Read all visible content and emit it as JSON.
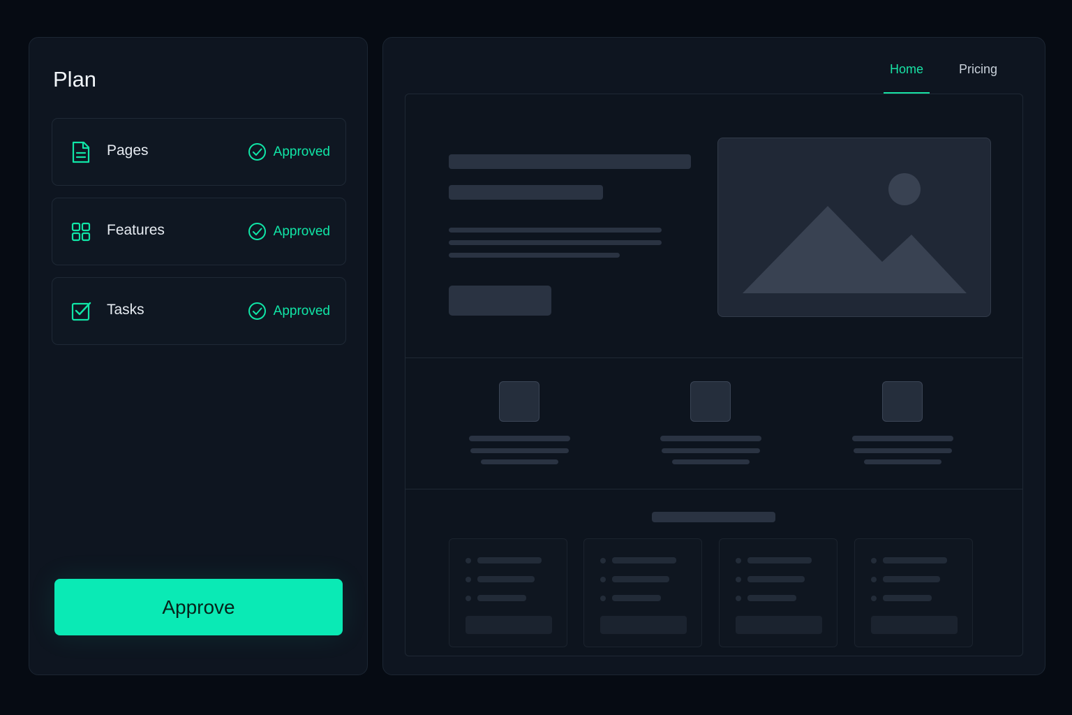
{
  "plan": {
    "title": "Plan",
    "items": [
      {
        "label": "Pages",
        "icon": "document-icon",
        "status": "Approved"
      },
      {
        "label": "Features",
        "icon": "grid-icon",
        "status": "Approved"
      },
      {
        "label": "Tasks",
        "icon": "checkbox-icon",
        "status": "Approved"
      }
    ],
    "approve_label": "Approve"
  },
  "preview": {
    "tabs": [
      {
        "label": "Home",
        "active": true
      },
      {
        "label": "Pricing",
        "active": false
      }
    ]
  },
  "colors": {
    "accent": "#0aeab5",
    "background": "#060b13",
    "panel": "#0e1520"
  }
}
